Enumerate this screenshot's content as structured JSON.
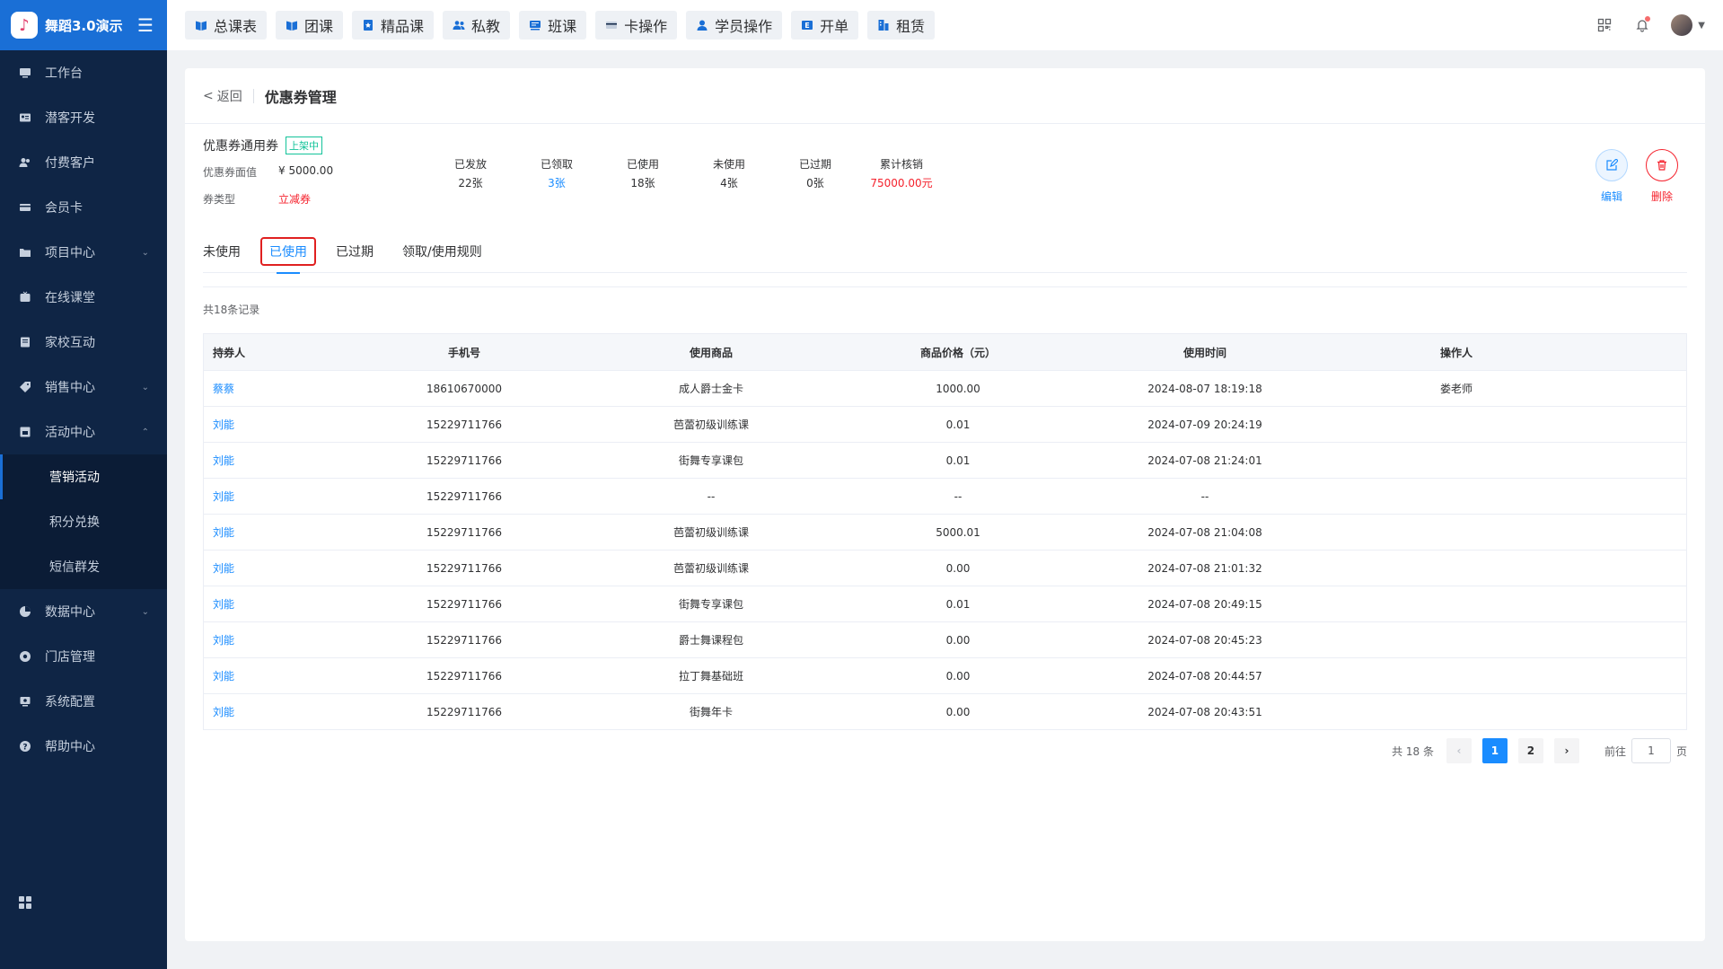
{
  "brand": {
    "name": "舞蹈3.0演示"
  },
  "sidebar": {
    "items": [
      {
        "label": "工作台",
        "icon": "monitor-icon",
        "expand": ""
      },
      {
        "label": "潜客开发",
        "icon": "id-card-icon",
        "expand": ""
      },
      {
        "label": "付费客户",
        "icon": "users-icon",
        "expand": ""
      },
      {
        "label": "会员卡",
        "icon": "card-icon",
        "expand": ""
      },
      {
        "label": "项目中心",
        "icon": "folder-icon",
        "expand": "down"
      },
      {
        "label": "在线课堂",
        "icon": "tv-icon",
        "expand": ""
      },
      {
        "label": "家校互动",
        "icon": "book-icon",
        "expand": ""
      },
      {
        "label": "销售中心",
        "icon": "tag-icon",
        "expand": "down"
      },
      {
        "label": "活动中心",
        "icon": "gift-icon",
        "expand": "up"
      },
      {
        "label": "营销活动",
        "sub": true,
        "active": true
      },
      {
        "label": "积分兑换",
        "sub": true
      },
      {
        "label": "短信群发",
        "sub": true
      },
      {
        "label": "数据中心",
        "icon": "pie-icon",
        "expand": "down"
      },
      {
        "label": "门店管理",
        "icon": "store-icon",
        "expand": ""
      },
      {
        "label": "系统配置",
        "icon": "settings-icon",
        "expand": ""
      },
      {
        "label": "帮助中心",
        "icon": "help-icon",
        "expand": ""
      }
    ]
  },
  "topnav": {
    "items": [
      {
        "label": "总课表",
        "icon": "book-open-icon"
      },
      {
        "label": "团课",
        "icon": "book-open-icon"
      },
      {
        "label": "精品课",
        "icon": "star-book-icon"
      },
      {
        "label": "私教",
        "icon": "people-icon"
      },
      {
        "label": "班课",
        "icon": "board-icon"
      },
      {
        "label": "卡操作",
        "icon": "card-icon"
      },
      {
        "label": "学员操作",
        "icon": "user-icon"
      },
      {
        "label": "开单",
        "icon": "receipt-icon"
      },
      {
        "label": "租赁",
        "icon": "building-icon"
      }
    ]
  },
  "header": {
    "back_label": "返回",
    "title": "优惠券管理"
  },
  "coupon": {
    "name": "优惠券通用券",
    "status": "上架中",
    "face_value_label": "优惠券面值",
    "face_value": "¥ 5000.00",
    "type_label": "券类型",
    "type": "立减券"
  },
  "stats": [
    {
      "label": "已发放",
      "value": "22张",
      "style": ""
    },
    {
      "label": "已领取",
      "value": "3张",
      "style": "blue"
    },
    {
      "label": "已使用",
      "value": "18张",
      "style": ""
    },
    {
      "label": "未使用",
      "value": "4张",
      "style": ""
    },
    {
      "label": "已过期",
      "value": "0张",
      "style": ""
    },
    {
      "label": "累计核销",
      "value": "75000.00元",
      "style": "red"
    }
  ],
  "actions": {
    "edit": "编辑",
    "delete": "删除"
  },
  "tabs": [
    {
      "label": "未使用",
      "active": false
    },
    {
      "label": "已使用",
      "active": true
    },
    {
      "label": "已过期",
      "active": false
    },
    {
      "label": "领取/使用规则",
      "active": false
    }
  ],
  "records_label": "共18条记录",
  "table": {
    "headers": [
      "持券人",
      "手机号",
      "使用商品",
      "商品价格（元）",
      "使用时间",
      "操作人"
    ],
    "rows": [
      [
        "蔡蔡",
        "18610670000",
        "成人爵士金卡",
        "1000.00",
        "2024-08-07 18:19:18",
        "娄老师"
      ],
      [
        "刘能",
        "15229711766",
        "芭蕾初级训练课",
        "0.01",
        "2024-07-09 20:24:19",
        ""
      ],
      [
        "刘能",
        "15229711766",
        "街舞专享课包",
        "0.01",
        "2024-07-08 21:24:01",
        ""
      ],
      [
        "刘能",
        "15229711766",
        "--",
        "--",
        "--",
        ""
      ],
      [
        "刘能",
        "15229711766",
        "芭蕾初级训练课",
        "5000.01",
        "2024-07-08 21:04:08",
        ""
      ],
      [
        "刘能",
        "15229711766",
        "芭蕾初级训练课",
        "0.00",
        "2024-07-08 21:01:32",
        ""
      ],
      [
        "刘能",
        "15229711766",
        "街舞专享课包",
        "0.01",
        "2024-07-08 20:49:15",
        ""
      ],
      [
        "刘能",
        "15229711766",
        "爵士舞课程包",
        "0.00",
        "2024-07-08 20:45:23",
        ""
      ],
      [
        "刘能",
        "15229711766",
        "拉丁舞基础班",
        "0.00",
        "2024-07-08 20:44:57",
        ""
      ],
      [
        "刘能",
        "15229711766",
        "街舞年卡",
        "0.00",
        "2024-07-08 20:43:51",
        ""
      ]
    ]
  },
  "pagination": {
    "total_label": "共 18 条",
    "pages": [
      "1",
      "2"
    ],
    "current": "1",
    "goto_label": "前往",
    "goto_value": "1",
    "page_suffix": "页"
  }
}
